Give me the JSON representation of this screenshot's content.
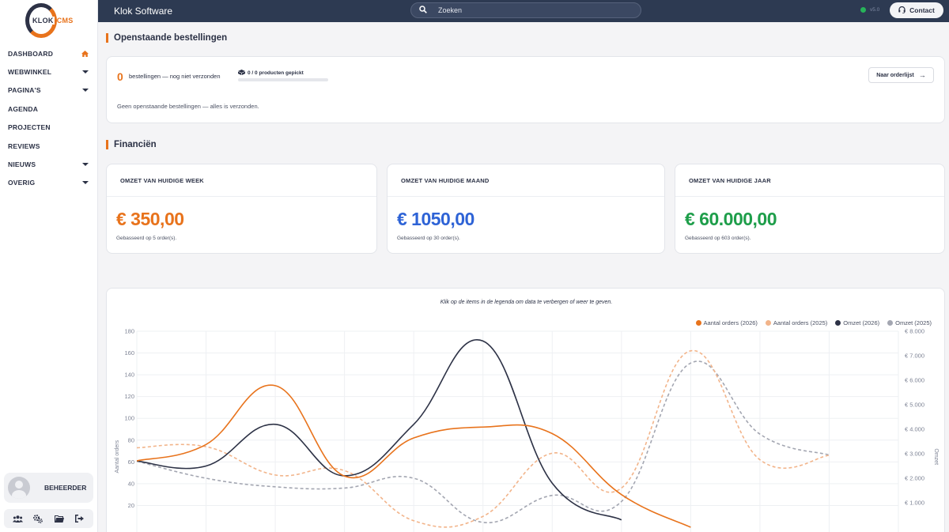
{
  "sidebar": {
    "logo": {
      "text_main": "KLOK",
      "text_accent": "CMS"
    },
    "items": [
      {
        "label": "DASHBOARD",
        "icon": "home-icon"
      },
      {
        "label": "WEBWINKEL",
        "icon": "chevron-down-icon"
      },
      {
        "label": "PAGINA'S",
        "icon": "chevron-down-icon"
      },
      {
        "label": "AGENDA",
        "icon": ""
      },
      {
        "label": "PROJECTEN",
        "icon": ""
      },
      {
        "label": "REVIEWS",
        "icon": ""
      },
      {
        "label": "NIEUWS",
        "icon": "chevron-down-icon"
      },
      {
        "label": "OVERIG",
        "icon": "chevron-down-icon"
      }
    ],
    "user": {
      "name": "BEHEERDER"
    },
    "actions": [
      "users-icon",
      "settings-icon",
      "folder-icon",
      "logout-icon"
    ]
  },
  "topbar": {
    "title": "Klok Software",
    "search_placeholder": "Zoeken",
    "version": "v5.0",
    "contact_label": "Contact"
  },
  "orders": {
    "title": "Openstaande bestellingen",
    "count": "0",
    "count_label": "bestellingen — nog niet verzonden",
    "picked_label": "0 / 0 producten gepickt",
    "picked_fraction": 0,
    "button_label": "Naar orderlijst",
    "empty_message": "Geen openstaande bestellingen — alles is verzonden."
  },
  "finance": {
    "title": "Financiën",
    "cards": [
      {
        "title": "OMZET VAN HUIDIGE WEEK",
        "value": "€ 350,00",
        "note": "Gebasseerd op 5 order(s).",
        "color": "#e8731c"
      },
      {
        "title": "OMZET VAN HUIDIGE MAAND",
        "value": "€ 1050,00",
        "note": "Gebasseerd op 30 order(s).",
        "color": "#2e63d6"
      },
      {
        "title": "OMZET VAN HUIDIGE JAAR",
        "value": "€ 60.000,00",
        "note": "Gebasseerd op 603 order(s).",
        "color": "#1e9e4a"
      }
    ]
  },
  "chart": {
    "hint": "Klik op de items in de legenda om data te verbergen of weer te geven.",
    "legend": [
      {
        "label": "Aantal orders (2026)",
        "color": "#e8731c"
      },
      {
        "label": "Aantal orders (2025)",
        "color": "#f2b48a"
      },
      {
        "label": "Omzet (2026)",
        "color": "#2d3246"
      },
      {
        "label": "Omzet (2025)",
        "color": "#a3a6b1"
      }
    ]
  },
  "chart_data": {
    "type": "line",
    "ylabel": "Aantal orders",
    "y2label": "Omzet",
    "ylim": [
      0,
      180
    ],
    "y2lim": [
      0,
      8000
    ],
    "y_ticks": [
      "180",
      "160",
      "140",
      "120",
      "100",
      "80",
      "60",
      "40",
      "20"
    ],
    "y2_ticks": [
      "€ 8.000",
      "€ 7.000",
      "€ 6.000",
      "€ 5.000",
      "€ 4.000",
      "€ 3.000",
      "€ 2.000",
      "€ 1.000"
    ],
    "x": [
      0,
      1,
      2,
      3,
      4,
      5,
      6,
      7,
      8,
      9,
      10,
      11
    ],
    "series": [
      {
        "name": "Aantal orders (2026)",
        "axis": "left",
        "dashed": false,
        "color": "#e8731c",
        "values": [
          61,
          76,
          130,
          47,
          82,
          92,
          86,
          30,
          0,
          null,
          null,
          null
        ]
      },
      {
        "name": "Aantal orders (2025)",
        "axis": "left",
        "dashed": true,
        "color": "#f2b48a",
        "values": [
          73,
          74,
          48,
          52,
          6,
          10,
          68,
          36,
          162,
          62,
          66,
          null
        ]
      },
      {
        "name": "Omzet (2026)",
        "axis": "right",
        "dashed": false,
        "color": "#2d3246",
        "values": [
          2700,
          2500,
          4200,
          2100,
          4200,
          7600,
          1800,
          300,
          null,
          null,
          null,
          null
        ]
      },
      {
        "name": "Omzet (2025)",
        "axis": "right",
        "dashed": true,
        "color": "#a3a6b1",
        "values": [
          2700,
          2000,
          1650,
          1600,
          2000,
          200,
          1300,
          1050,
          6700,
          3800,
          2950,
          null
        ]
      }
    ]
  }
}
